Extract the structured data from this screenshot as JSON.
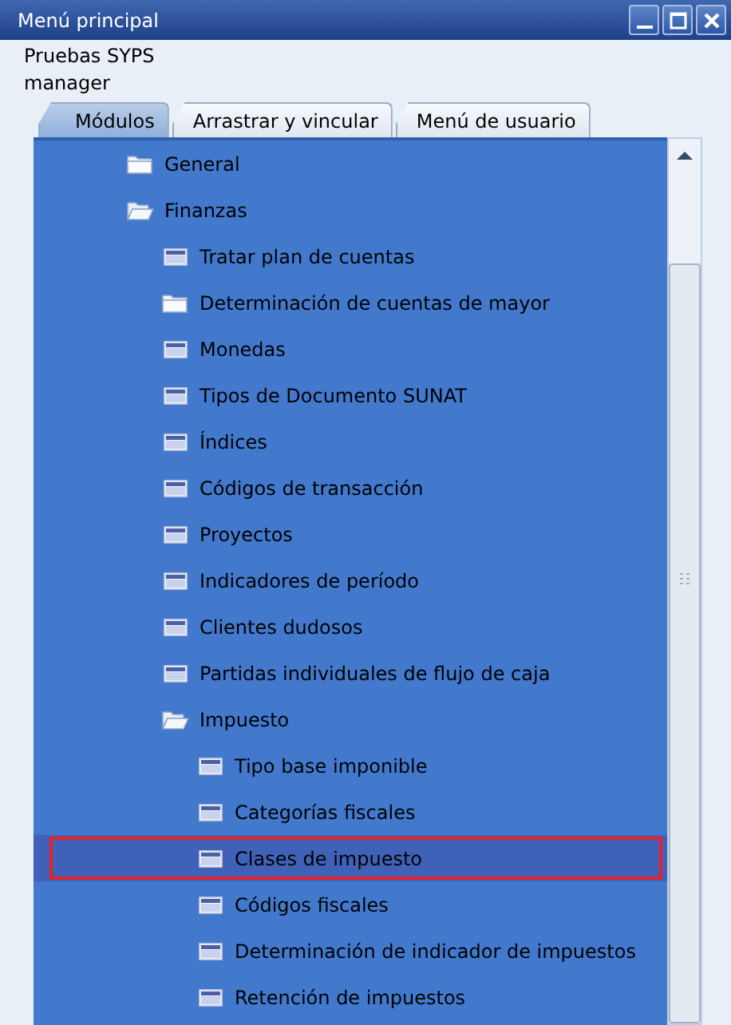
{
  "window": {
    "title": "Menú principal"
  },
  "company": "Pruebas SYPS",
  "user": "manager",
  "tabs": [
    {
      "label": "Módulos",
      "selected": true
    },
    {
      "label": "Arrastrar y vincular",
      "selected": false
    },
    {
      "label": "Menú de usuario",
      "selected": false
    }
  ],
  "tree": [
    {
      "label": "General",
      "kind": "folder",
      "expanded": false,
      "selected": false
    },
    {
      "label": "Finanzas",
      "kind": "folder",
      "expanded": true,
      "selected": false,
      "children": [
        {
          "label": "Tratar plan de cuentas",
          "kind": "form",
          "selected": false
        },
        {
          "label": "Determinación de cuentas de mayor",
          "kind": "folder",
          "expanded": false,
          "selected": false
        },
        {
          "label": "Monedas",
          "kind": "form",
          "selected": false
        },
        {
          "label": "Tipos de Documento SUNAT",
          "kind": "form",
          "selected": false
        },
        {
          "label": "Índices",
          "kind": "form",
          "selected": false
        },
        {
          "label": "Códigos de transacción",
          "kind": "form",
          "selected": false
        },
        {
          "label": "Proyectos",
          "kind": "form",
          "selected": false
        },
        {
          "label": "Indicadores de período",
          "kind": "form",
          "selected": false
        },
        {
          "label": "Clientes dudosos",
          "kind": "form",
          "selected": false
        },
        {
          "label": "Partidas individuales de flujo de caja",
          "kind": "form",
          "selected": false
        },
        {
          "label": "Impuesto",
          "kind": "folder",
          "expanded": true,
          "selected": false,
          "children": [
            {
              "label": "Tipo base imponible",
              "kind": "form",
              "selected": false
            },
            {
              "label": "Categorías fiscales",
              "kind": "form",
              "selected": false
            },
            {
              "label": "Clases de impuesto",
              "kind": "form",
              "selected": true
            },
            {
              "label": "Códigos fiscales",
              "kind": "form",
              "selected": false
            },
            {
              "label": "Determinación de indicador de impuestos",
              "kind": "form",
              "selected": false
            },
            {
              "label": "Retención de impuestos",
              "kind": "form",
              "selected": false
            }
          ]
        }
      ]
    }
  ]
}
